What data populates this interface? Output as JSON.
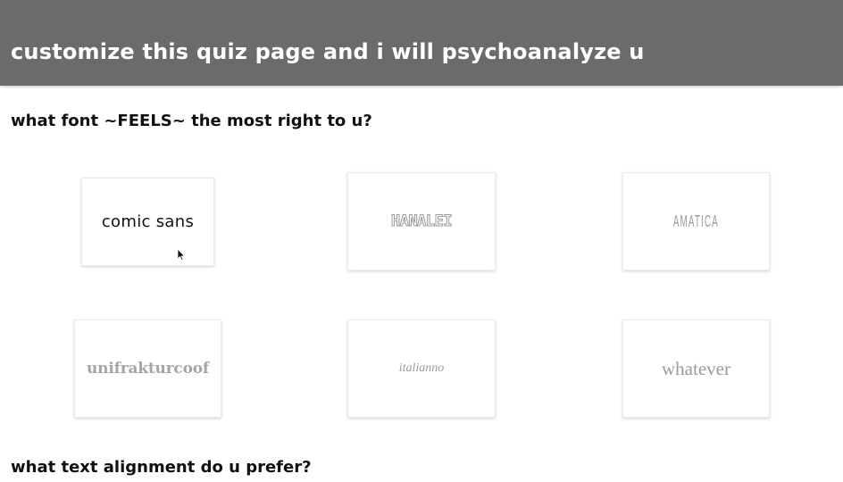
{
  "header": {
    "title": "customize this quiz page and i will psychoanalyze u"
  },
  "questions": [
    {
      "text": "what font ~FEELS~ the most right to u?",
      "options": [
        {
          "label": "comic sans"
        },
        {
          "label": "HANALEI"
        },
        {
          "label": "AMATICA"
        },
        {
          "label": "unifrakturcoof"
        },
        {
          "label": "italianno"
        },
        {
          "label": "whatever"
        }
      ]
    },
    {
      "text": "what text alignment do u prefer?"
    }
  ],
  "colors": {
    "header_bg": "#6b6b6b",
    "header_text": "#ffffff",
    "option_text_muted": "#9a9a9a"
  },
  "cursor": {
    "icon": "mouse-pointer-icon"
  }
}
